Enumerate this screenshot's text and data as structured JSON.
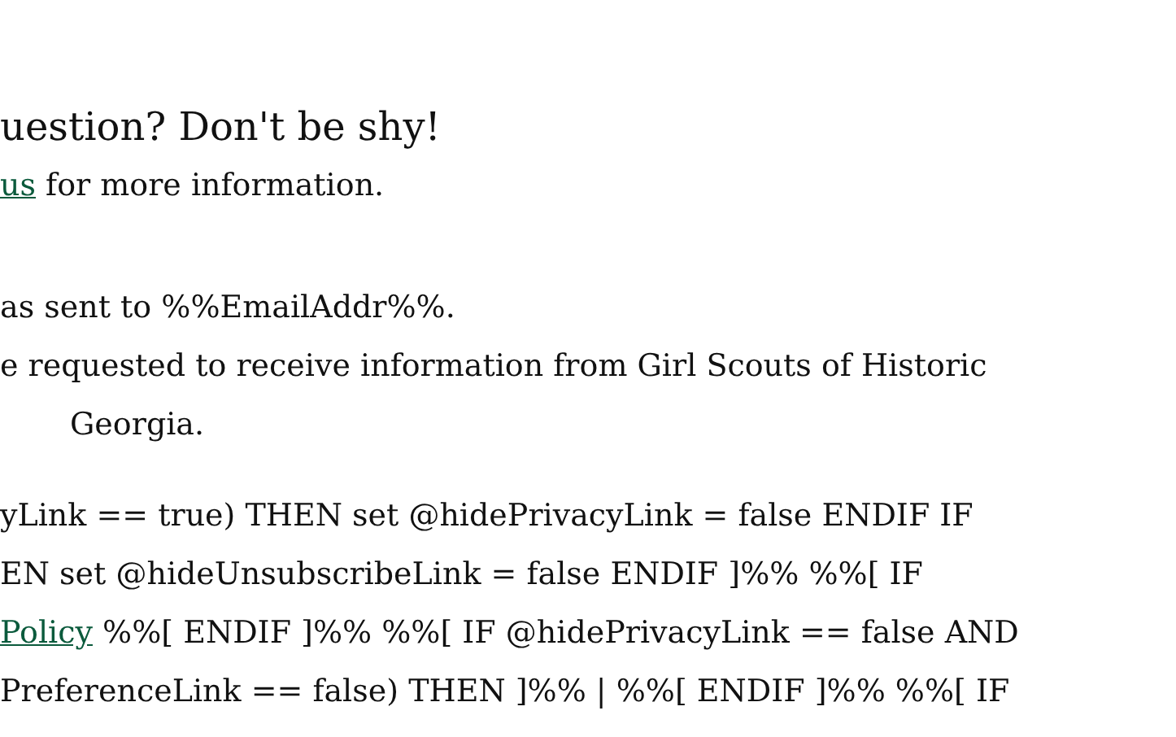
{
  "heading": "uestion? Don't be shy!",
  "contact": {
    "link": "us",
    "text": " for more information."
  },
  "notice_lines": [
    {
      "text": "as sent to %%EmailAddr%%.",
      "indented": false
    },
    {
      "text": "e requested to receive information from Girl Scouts of Historic",
      "indented": false
    },
    {
      "text": "Georgia.",
      "indented": true
    }
  ],
  "template_lines": [
    {
      "text": "yLink == true) THEN set @hidePrivacyLink = false ENDIF IF"
    },
    {
      "text": "EN set @hideUnsubscribeLink = false ENDIF ]%% %%[ IF"
    },
    {
      "link": "Policy",
      "text": " %%[ ENDIF ]%% %%[ IF @hidePrivacyLink == false AND"
    },
    {
      "text": "PreferenceLink == false) THEN ]%% | %%[ ENDIF ]%% %%[ IF"
    }
  ]
}
